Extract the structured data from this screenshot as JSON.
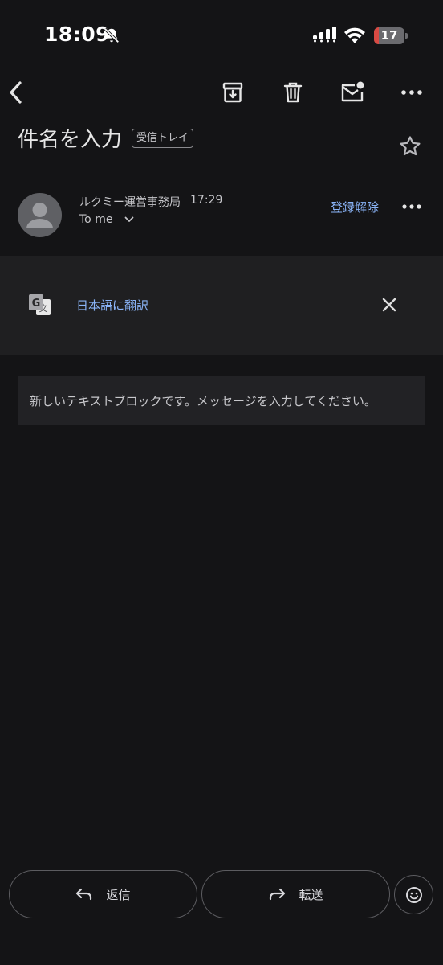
{
  "status_bar": {
    "time": "18:09",
    "battery_level": "17",
    "battery_fraction": 0.17,
    "icons": [
      "bell-slash-icon",
      "signal-icon",
      "wifi-icon",
      "battery-icon"
    ]
  },
  "toolbar": {
    "icons": [
      "back-arrow-icon",
      "archive-icon",
      "trash-icon",
      "mark-unread-icon",
      "more-horizontal-icon"
    ]
  },
  "email": {
    "subject": "件名を入力",
    "label": "受信トレイ",
    "sender": "ルクミー運営事務局",
    "time": "17:29",
    "recipient": "To me",
    "unsubscribe": "登録解除"
  },
  "translate": {
    "link": "日本語に翻訳",
    "icon": "google-translate-icon"
  },
  "message": {
    "body": "新しいテキストブロックです。メッセージを入力してください。"
  },
  "actions": {
    "reply": "返信",
    "forward": "転送"
  },
  "colors": {
    "background": "#141416",
    "accent_link": "#8ab4f8",
    "translate_bar": "#1f1f21",
    "battery_low": "#d94a43"
  }
}
